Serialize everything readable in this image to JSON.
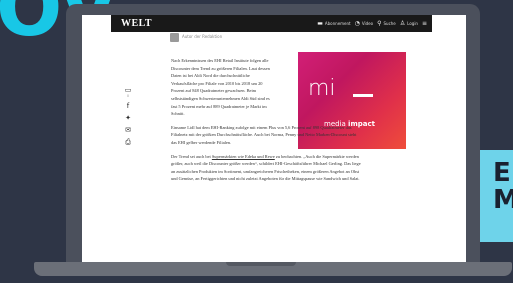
{
  "background": {
    "headline_fragment": "OV",
    "side_text": "E M"
  },
  "site": {
    "logo": "WELT",
    "nav": [
      {
        "icon": "document-icon",
        "label": "Abonnement"
      },
      {
        "icon": "play-icon",
        "label": "Video"
      },
      {
        "icon": "search-icon",
        "label": "Suche"
      },
      {
        "icon": "user-icon",
        "label": "Login"
      },
      {
        "icon": "menu-icon",
        "label": ""
      }
    ]
  },
  "byline": {
    "text": "Autor der Redaktion"
  },
  "share": {
    "count": "0"
  },
  "ad": {
    "brand_main": "mi",
    "brand_media": "media",
    "brand_impact": "impact"
  },
  "article": {
    "p1": "Nach Erkenntnissen des EHI Retail Institute folgen alle Discounter dem Trend zu größeren Filialen. Laut dessen Daten ist bei Aldi Nord die durchschnittliche Verkaufsfläche pro Filiale von 2010 bis 2018 um 20 Prozent auf 848 Quadratmeter gewachsen. Beim selbstständigen Schwesterunternehmen Aldi Süd sind es fast 5 Prozent mehr auf 889 Quadratmeter je Markt im Schnitt.",
    "p2": "Einsame Lidl hat dem EHI-Ranking zufolge mit einem Plus von 5,6 Prozent auf 898 Quadratmeter das Filialnetz mit der größten Durchschnittsfläche. Auch bei Norma, Penny und Netto Marken-Discount steht das EHI gelber werdende Filialen.",
    "p3_before": "Der Trend sei auch bei ",
    "p3_link": "Supermärkten wie Edeka und Rewe",
    "p3_after": " zu beobachten. „Auch die Supermärkte werden größer, auch weil die Discounter größer werden“, schildert EHI-Geschäftsführer Michael Gerling. Das liege an zusätzlichen Produkten im Sortiment, umfangreicheren Frischetheken, einem größeren Angebot an Obst und Gemüse, an Fertiggerichten und nicht zuletzt Angeboten für die Mittagspause wie Sandwich und Salat."
  }
}
